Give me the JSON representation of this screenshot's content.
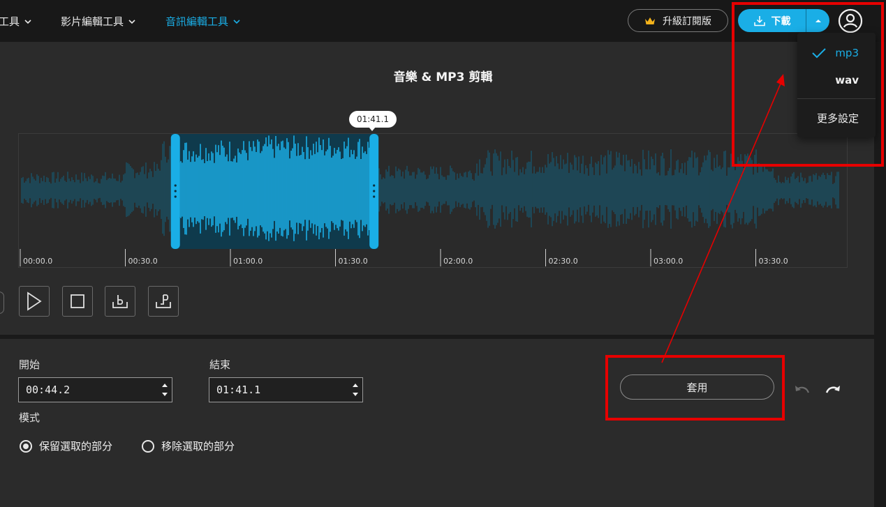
{
  "nav": {
    "items": [
      {
        "label": "工具"
      },
      {
        "label": "影片編輯工具"
      },
      {
        "label": "音訊編輯工具"
      }
    ],
    "upgrade_label": "升級訂閱版",
    "download_label": "下載"
  },
  "download_menu": {
    "options": [
      {
        "label": "mp3",
        "selected": true
      },
      {
        "label": "wav",
        "selected": false
      }
    ],
    "more_settings_label": "更多設定"
  },
  "editor": {
    "title": "音樂 & MP3 剪輯",
    "current_time_bubble": "01:41.1",
    "timeline_ticks": [
      "00:00.0",
      "00:30.0",
      "01:00.0",
      "01:30.0",
      "02:00.0",
      "02:30.0",
      "03:00.0",
      "03:30.0"
    ],
    "duration_seconds": 234.0,
    "selection": {
      "start_seconds": 44.2,
      "end_seconds": 101.1
    },
    "colors": {
      "accent": "#1aaee6",
      "waveform_dim": "#1b4e60",
      "selected_bg": "#0f3a4c"
    }
  },
  "controls": {
    "play_icon": "play-icon",
    "stop_icon": "stop-icon",
    "set_start_icon": "set-start-icon",
    "set_end_icon": "set-end-icon"
  },
  "trim": {
    "start_label": "開始",
    "start_value": "00:44.2",
    "end_label": "結束",
    "end_value": "01:41.1",
    "mode_label": "模式",
    "modes": [
      {
        "label": "保留選取的部分",
        "selected": true
      },
      {
        "label": "移除選取的部分",
        "selected": false
      }
    ],
    "apply_label": "套用"
  }
}
